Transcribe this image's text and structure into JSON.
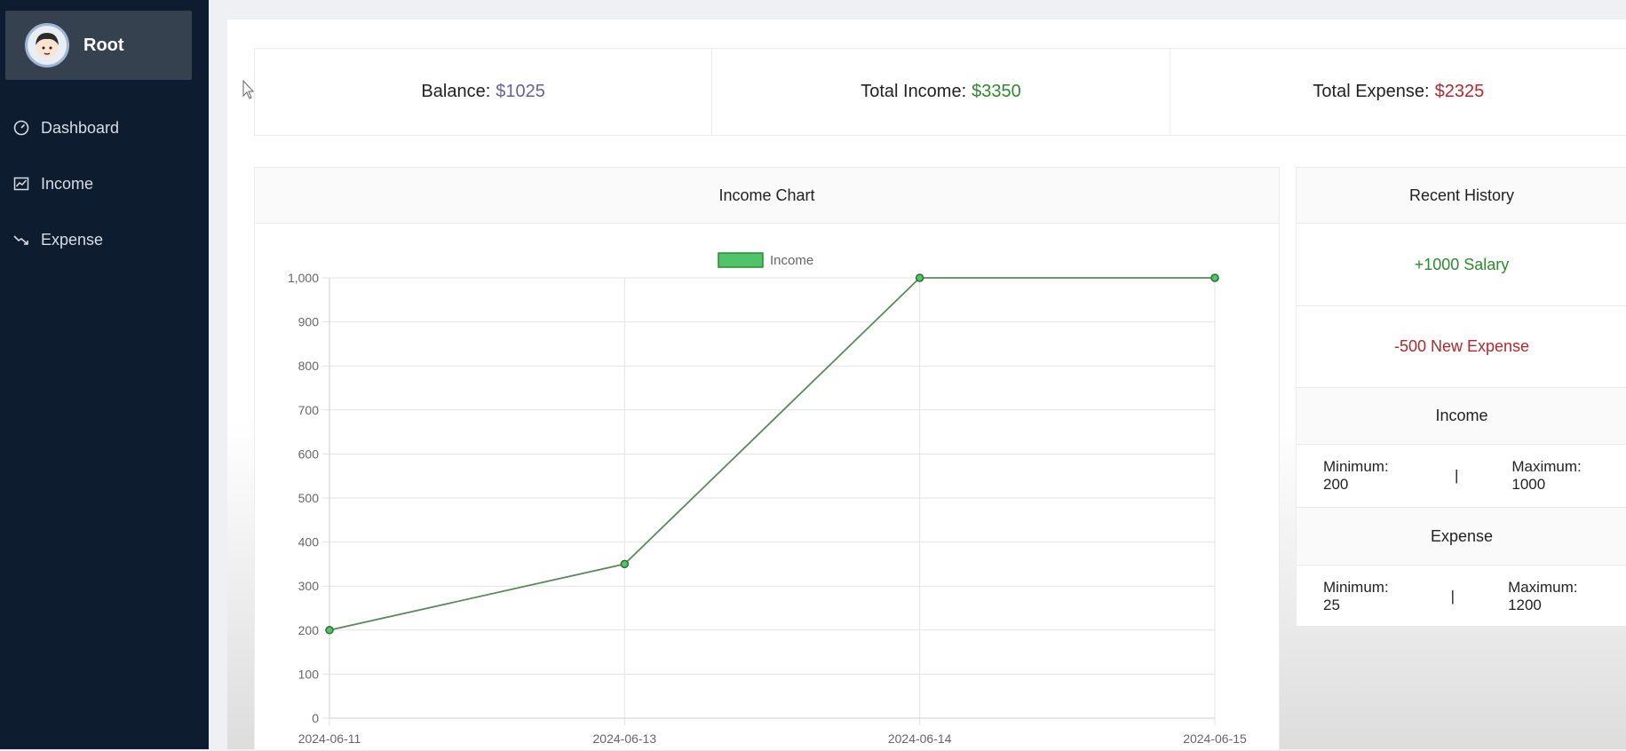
{
  "sidebar": {
    "user_name": "Root",
    "items": [
      {
        "label": "Dashboard",
        "icon": "gauge-icon"
      },
      {
        "label": "Income",
        "icon": "chart-line-icon"
      },
      {
        "label": "Expense",
        "icon": "trend-down-icon"
      }
    ]
  },
  "stats": {
    "balance_label": "Balance:",
    "balance_value": "$1025",
    "income_label": "Total Income:",
    "income_value": "$3350",
    "expense_label": "Total Expense:",
    "expense_value": "$2325"
  },
  "colors": {
    "balance": "#6b5fa0",
    "income": "#2f8a2f",
    "expense": "#b2282f",
    "sidebar_bg": "#0d1c2e",
    "line": "#5a8a5a",
    "legend_fill": "#4fc46a"
  },
  "chart_data": {
    "type": "line",
    "title": "Income Chart",
    "x": [
      "2024-06-11",
      "2024-06-13",
      "2024-06-14",
      "2024-06-15"
    ],
    "series": [
      {
        "name": "Income",
        "values": [
          200,
          350,
          1000,
          1000
        ]
      }
    ],
    "yticks": [
      "0",
      "100",
      "200",
      "300",
      "400",
      "500",
      "600",
      "700",
      "800",
      "900",
      "1,000"
    ],
    "ylim": [
      0,
      1000
    ],
    "grid": true,
    "legend": "top-center"
  },
  "history": {
    "title": "Recent History",
    "items": [
      {
        "text": "+1000 Salary",
        "kind": "income"
      },
      {
        "text": "-500 New Expense",
        "kind": "expense"
      }
    ],
    "income": {
      "title": "Income",
      "min": "Minimum: 200",
      "sep": "|",
      "max": "Maximum: 1000"
    },
    "expense": {
      "title": "Expense",
      "min": "Minimum: 25",
      "sep": "|",
      "max": "Maximum: 1200"
    }
  }
}
